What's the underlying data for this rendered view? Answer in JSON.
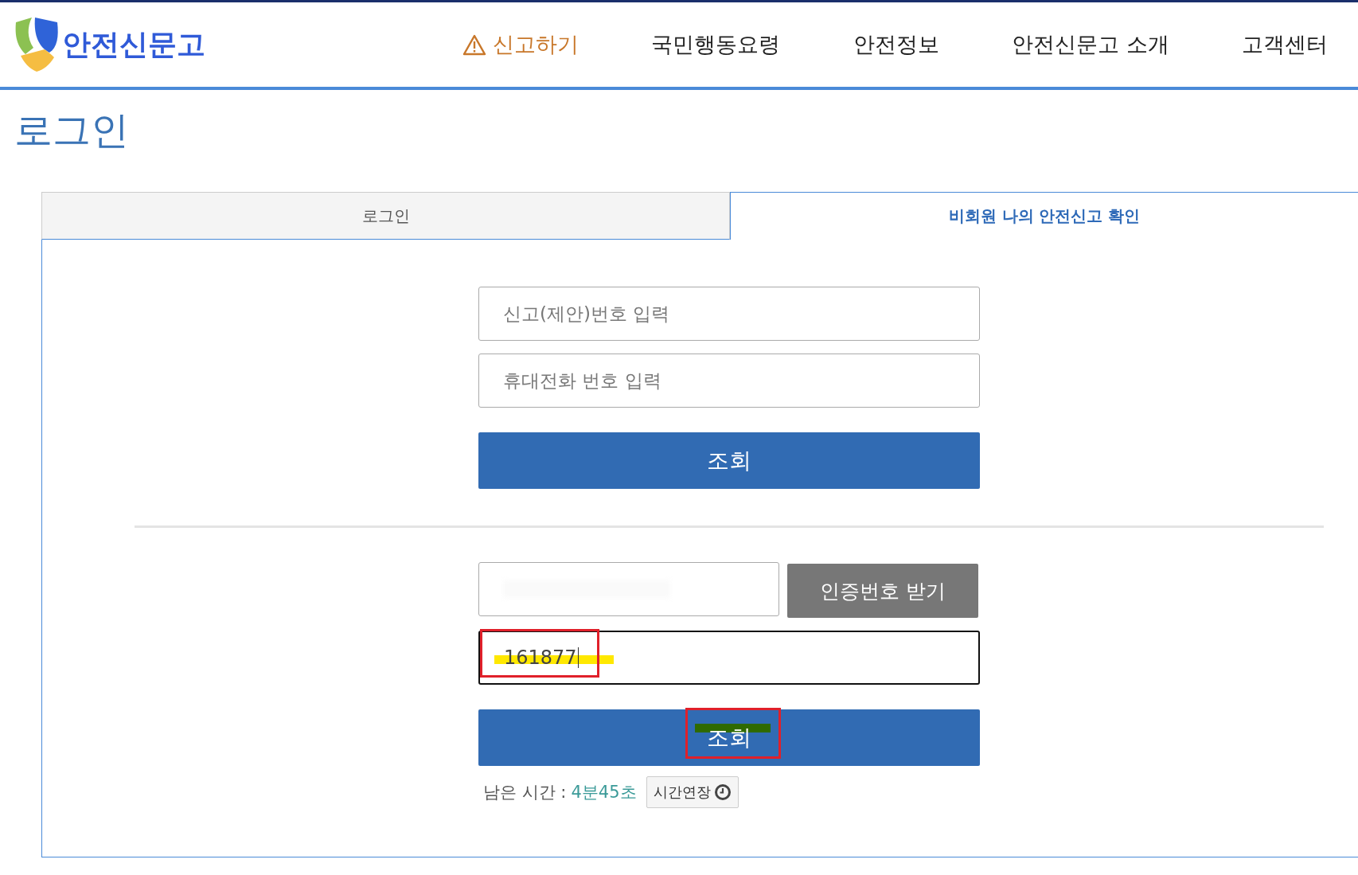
{
  "header": {
    "logo_text": "안전신문고",
    "nav": [
      {
        "label": "신고하기",
        "kind": "alert"
      },
      {
        "label": "국민행동요령",
        "kind": "plain"
      },
      {
        "label": "안전정보",
        "kind": "plain"
      },
      {
        "label": "안전신문고 소개",
        "kind": "plain"
      },
      {
        "label": "고객센터",
        "kind": "plain"
      }
    ]
  },
  "page_title": "로그인",
  "tabs": [
    {
      "label": "로그인",
      "selected": false
    },
    {
      "label": "비회원 나의 안전신고 확인",
      "selected": true
    }
  ],
  "lookup_form": {
    "report_number": {
      "placeholder": "신고(제안)번호 입력"
    },
    "phone": {
      "placeholder": "휴대전화 번호 입력"
    },
    "button": "조회"
  },
  "verify_form": {
    "phone": {
      "blurred": true
    },
    "send_button": "인증번호 받기",
    "code": {
      "value": "161877",
      "focused": true,
      "annotated": true
    },
    "button": {
      "label": "조회",
      "annotated": true
    },
    "timer": {
      "label": "남은 시간 :",
      "value": "4분45초",
      "extend_button": "시간연장"
    }
  }
}
